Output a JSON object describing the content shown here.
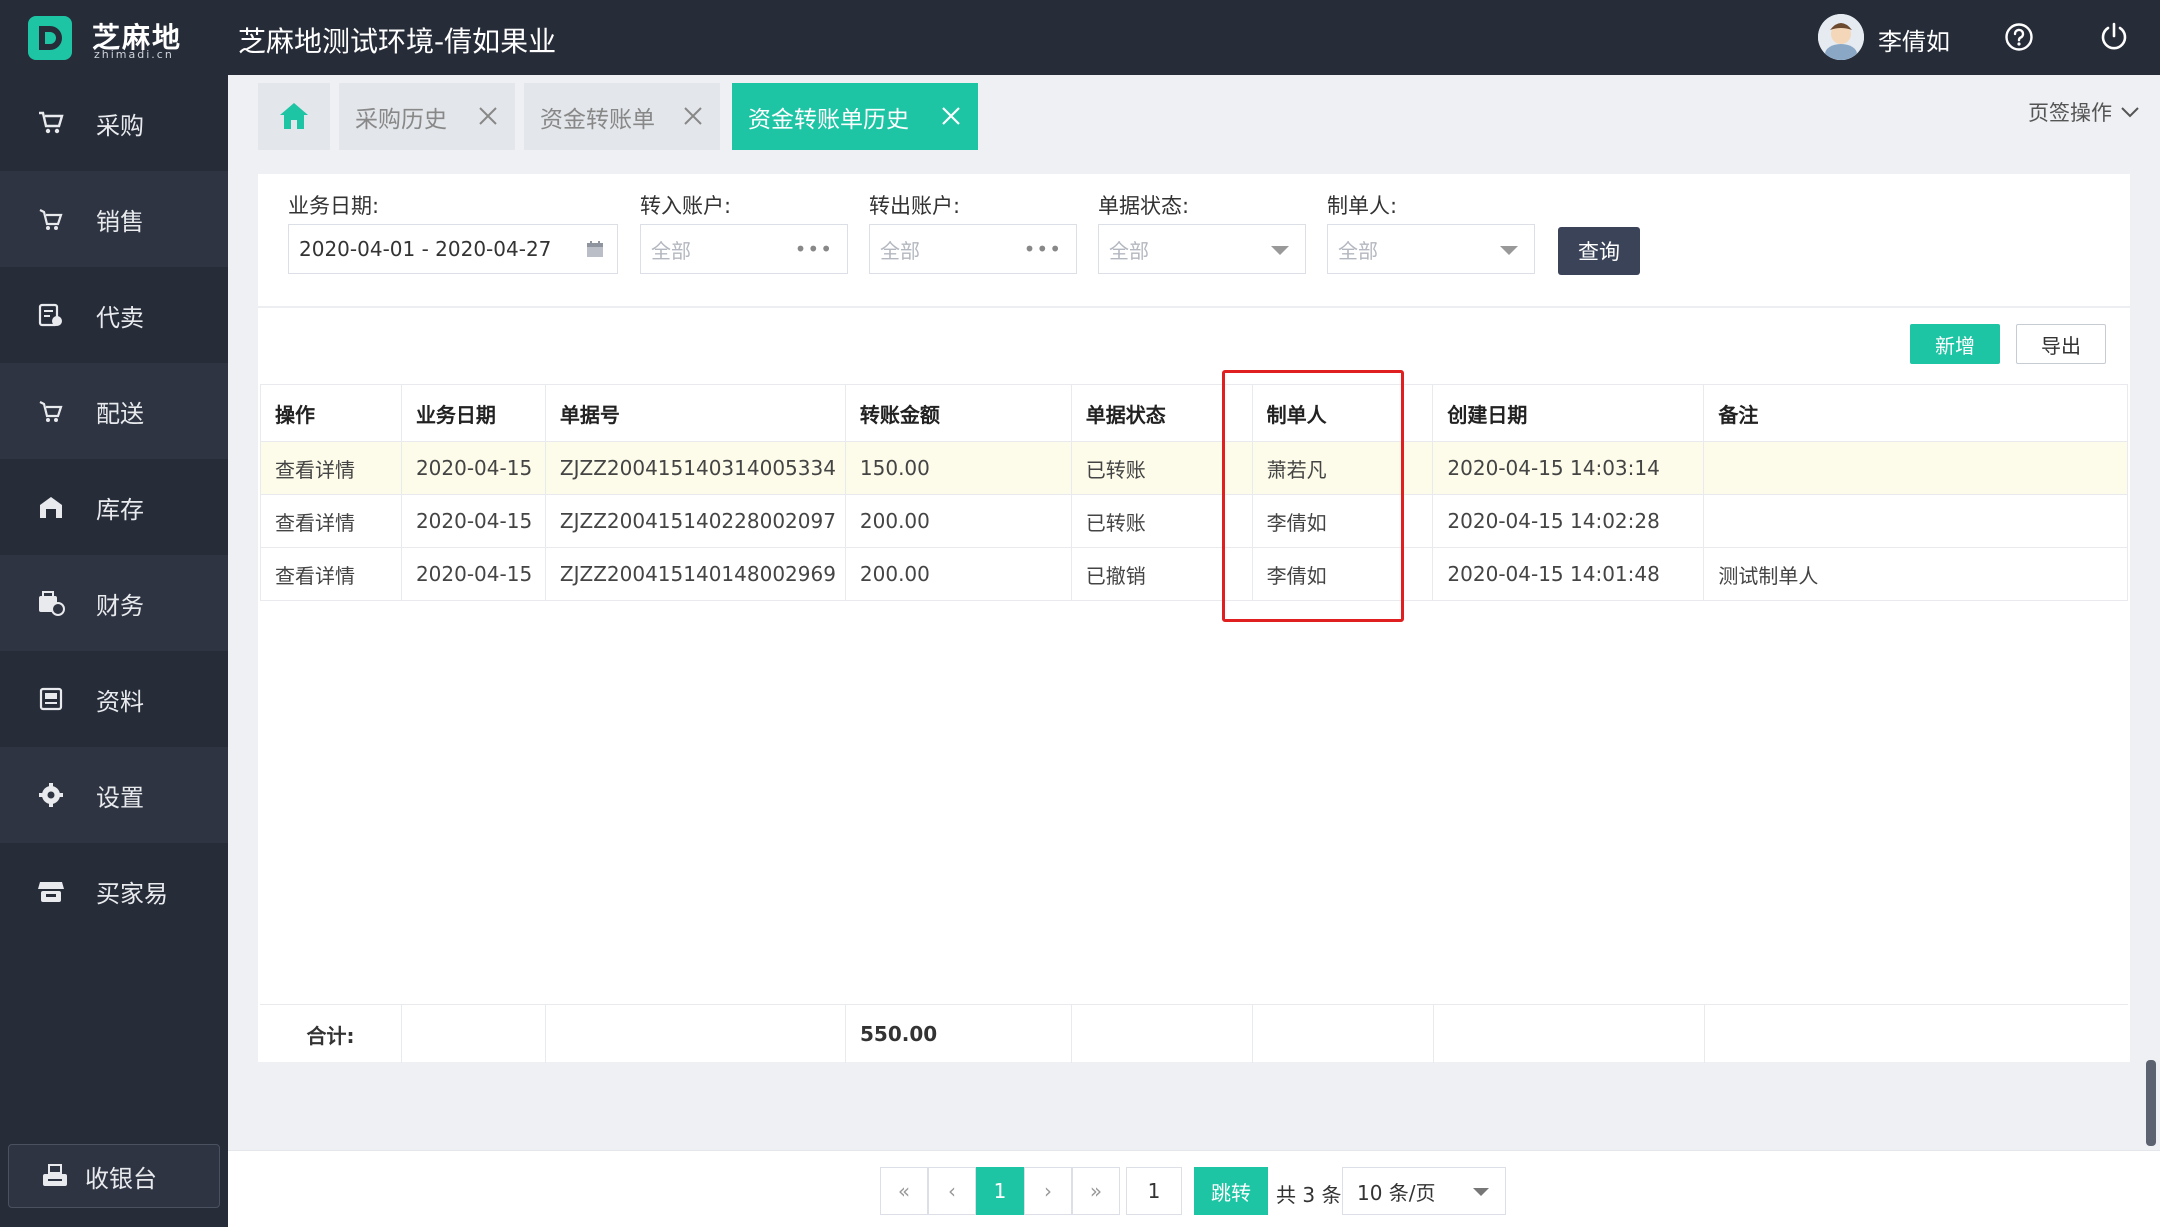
{
  "header": {
    "logo_text": "芝麻地",
    "logo_sub": "zhimadi.cn",
    "app_title": "芝麻地测试环境-倩如果业",
    "user_name": "李倩如",
    "icons": [
      "help-icon",
      "power-icon"
    ]
  },
  "sidebar": {
    "items": [
      {
        "label": "采购",
        "icon": "cart-icon"
      },
      {
        "label": "销售",
        "icon": "sale-cart-icon"
      },
      {
        "label": "代卖",
        "icon": "consign-icon"
      },
      {
        "label": "配送",
        "icon": "delivery-cart-icon"
      },
      {
        "label": "库存",
        "icon": "warehouse-icon"
      },
      {
        "label": "财务",
        "icon": "finance-icon"
      },
      {
        "label": "资料",
        "icon": "archive-icon"
      },
      {
        "label": "设置",
        "icon": "gear-icon"
      },
      {
        "label": "买家易",
        "icon": "store-icon"
      }
    ],
    "cashier_label": "收银台"
  },
  "tabs": {
    "items": [
      {
        "label": "采购历史",
        "active": false
      },
      {
        "label": "资金转账单",
        "active": false
      },
      {
        "label": "资金转账单历史",
        "active": true
      }
    ],
    "page_ops_label": "页签操作"
  },
  "filters": {
    "date": {
      "label": "业务日期:",
      "value": "2020-04-01 - 2020-04-27"
    },
    "in_account": {
      "label": "转入账户:",
      "placeholder": "全部"
    },
    "out_account": {
      "label": "转出账户:",
      "placeholder": "全部"
    },
    "status": {
      "label": "单据状态:",
      "placeholder": "全部"
    },
    "creator": {
      "label": "制单人:",
      "placeholder": "全部"
    },
    "query_label": "查询"
  },
  "actions": {
    "add_label": "新增",
    "export_label": "导出"
  },
  "table": {
    "columns": [
      "操作",
      "业务日期",
      "单据号",
      "转账金额",
      "单据状态",
      "制单人",
      "创建日期",
      "备注"
    ],
    "rows": [
      {
        "op": "查看详情",
        "date": "2020-04-15",
        "no": "ZJZZ200415140314005334",
        "amount": "150.00",
        "status": "已转账",
        "creator": "萧若凡",
        "created": "2020-04-15 14:03:14",
        "remark": ""
      },
      {
        "op": "查看详情",
        "date": "2020-04-15",
        "no": "ZJZZ200415140228002097",
        "amount": "200.00",
        "status": "已转账",
        "creator": "李倩如",
        "created": "2020-04-15 14:02:28",
        "remark": ""
      },
      {
        "op": "查看详情",
        "date": "2020-04-15",
        "no": "ZJZZ200415140148002969",
        "amount": "200.00",
        "status": "已撤销",
        "creator": "李倩如",
        "created": "2020-04-15 14:01:48",
        "remark": "测试制单人"
      }
    ],
    "total_label": "合计:",
    "total_amount": "550.00"
  },
  "pagination": {
    "first": "«",
    "prev": "‹",
    "current": "1",
    "next": "›",
    "last": "»",
    "jump_value": "1",
    "jump_label": "跳转",
    "total_text": "共 3 条",
    "page_size": "10 条/页"
  },
  "colors": {
    "accent": "#1ec5a4",
    "sidebar": "#262c38",
    "query_button": "#3a4358",
    "highlight_box": "#e02020"
  }
}
